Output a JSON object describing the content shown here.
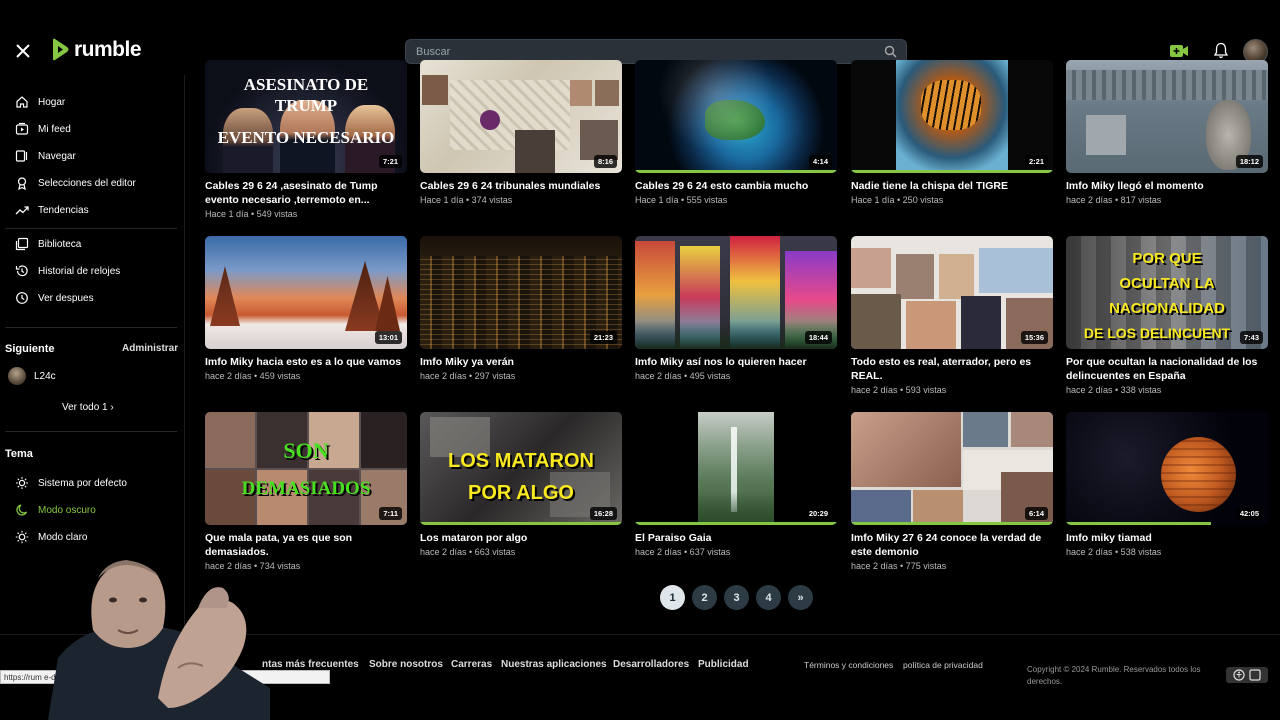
{
  "header": {
    "logo_text": "rumble",
    "search_placeholder": "Buscar",
    "icons": [
      "close-icon",
      "search-icon",
      "upload-video-icon",
      "bell-icon"
    ]
  },
  "sidebar": {
    "nav": [
      {
        "label": "Hogar",
        "icon": "home-icon"
      },
      {
        "label": "Mi feed",
        "icon": "feed-icon"
      },
      {
        "label": "Navegar",
        "icon": "browse-icon"
      },
      {
        "label": "Selecciones del editor",
        "icon": "award-icon"
      },
      {
        "label": "Tendencias",
        "icon": "trending-icon"
      }
    ],
    "library": [
      {
        "label": "Biblioteca",
        "icon": "library-icon"
      },
      {
        "label": "Historial de relojes",
        "icon": "history-icon"
      },
      {
        "label": "Ver despues",
        "icon": "clock-icon"
      }
    ],
    "following_title": "Siguiente",
    "manage_label": "Administrar",
    "channels": [
      {
        "name": "L24c"
      }
    ],
    "see_all": "Ver todo 1 ›",
    "theme_title": "Tema",
    "theme_options": [
      {
        "label": "Sistema por defecto",
        "icon": "system-icon",
        "active": false
      },
      {
        "label": "Modo oscuro",
        "icon": "moon-icon",
        "active": true
      },
      {
        "label": "Modo claro",
        "icon": "sun-icon",
        "active": false
      }
    ]
  },
  "videos": [
    {
      "title": "Cables 29 6 24 ,asesinato de Tump evento necesario ,terremoto en...",
      "meta": "Hace 1 día • 549 vistas",
      "duration": "7:21",
      "overlay": [
        "ASESINATO DE",
        "TRUMP",
        "EVENTO NECESARIO"
      ]
    },
    {
      "title": "Cables 29 6 24 tribunales mundiales",
      "meta": "Hace 1 día • 374 vistas",
      "duration": "8:16"
    },
    {
      "title": "Cables 29 6 24 esto cambia mucho",
      "meta": "Hace 1 día • 555 vistas",
      "duration": "4:14"
    },
    {
      "title": "Nadie tiene la chispa del TIGRE",
      "meta": "Hace 1 día • 250 vistas",
      "duration": "2:21"
    },
    {
      "title": "Imfo Miky llegó el momento",
      "meta": "hace 2 días • 817 vistas",
      "duration": "18:12"
    },
    {
      "title": "Imfo Miky hacia esto es a lo que vamos",
      "meta": "hace 2 días • 459 vistas",
      "duration": "13:01"
    },
    {
      "title": "Imfo Miky ya verán",
      "meta": "hace 2 días • 297 vistas",
      "duration": "21:23"
    },
    {
      "title": "Imfo Miky así nos lo quieren hacer",
      "meta": "hace 2 días • 495 vistas",
      "duration": "18:44"
    },
    {
      "title": "Todo esto es real, aterrador, pero es REAL.",
      "meta": "hace 2 días • 593 vistas",
      "duration": "15:36"
    },
    {
      "title": "Por que ocultan la nacionalidad de los delincuentes en España",
      "meta": "hace 2 días • 338 vistas",
      "duration": "7:43",
      "overlay": [
        "POR QUE",
        "OCULTAN LA",
        "NACIONALIDAD",
        "DE LOS DELINCUENT"
      ]
    },
    {
      "title": "Que mala pata, ya es que son demasiados.",
      "meta": "hace 2 días • 734 vistas",
      "duration": "7:11",
      "overlay": [
        "SON",
        "DEMASIADOS"
      ]
    },
    {
      "title": "Los mataron por algo",
      "meta": "hace 2 días • 663 vistas",
      "duration": "16:28",
      "overlay": [
        "LOS MATARON",
        "POR ALGO"
      ]
    },
    {
      "title": "El Paraiso Gaia",
      "meta": "hace 2 días • 637 vistas",
      "duration": "20:29"
    },
    {
      "title": "Imfo Miky 27 6 24 conoce la verdad de este demonio",
      "meta": "hace 2 días • 775 vistas",
      "duration": "6:14"
    },
    {
      "title": "Imfo miky tiamad",
      "meta": "hace 2 días • 538 vistas",
      "duration": "42:05"
    }
  ],
  "pagination": {
    "pages": [
      "1",
      "2",
      "3",
      "4"
    ],
    "next": "»",
    "current": "1"
  },
  "footer": {
    "links": [
      "ntas más frecuentes",
      "Sobre nosotros",
      "Carreras",
      "Nuestras aplicaciones",
      "Desarrolladores",
      "Publicidad"
    ],
    "legal": [
      "Términos y condiciones",
      "política de privacidad"
    ],
    "copyright": "Copyright © 2024 Rumble. Reservados todos los derechos."
  },
  "status_url": "https://rum                                  e-demonio.html",
  "colors": {
    "accent": "#85c742",
    "search_bg": "#2a3138",
    "page_button": "#2c3b44"
  }
}
